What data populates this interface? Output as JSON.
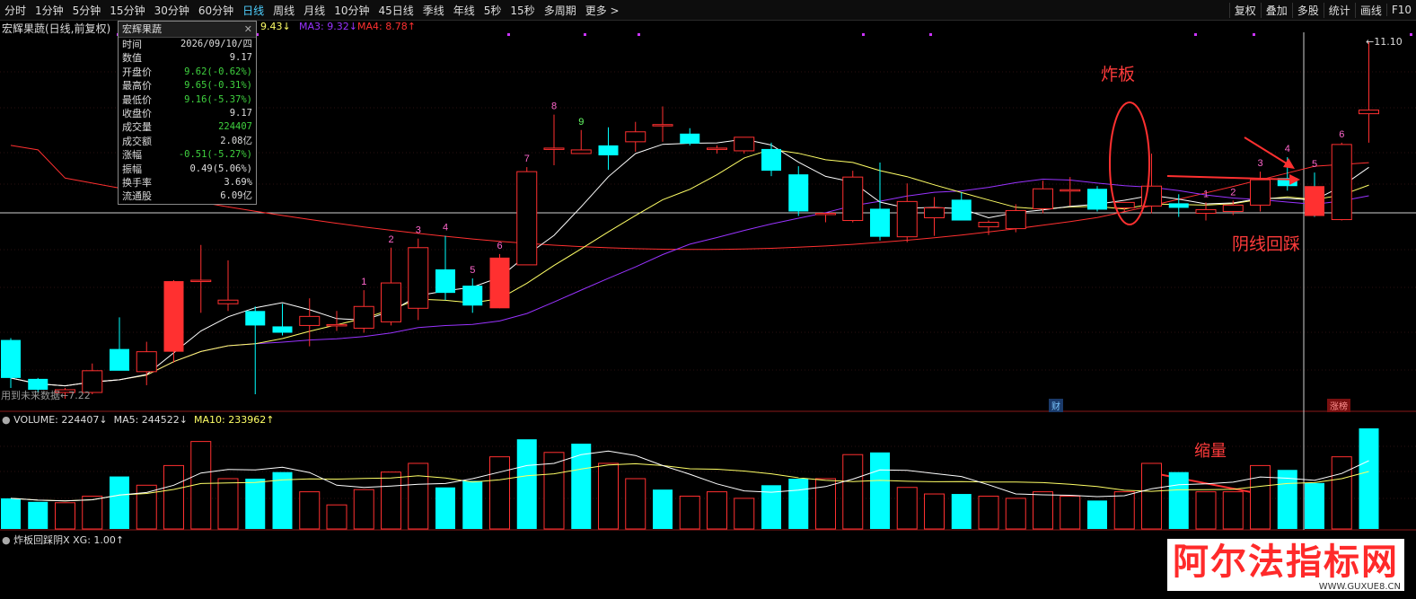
{
  "toolbar": {
    "periods": [
      "分时",
      "1分钟",
      "5分钟",
      "15分钟",
      "30分钟",
      "60分钟",
      "日线",
      "周线",
      "月线",
      "10分钟",
      "45日线",
      "季线",
      "年线",
      "5秒",
      "15秒",
      "多周期",
      "更多 >"
    ],
    "active_period": "日线",
    "tools": [
      "复权",
      "叠加",
      "多股",
      "统计",
      "画线",
      "F10"
    ]
  },
  "header": {
    "stock_title": "宏辉果蔬(日线,前复权)",
    "ma2": "9.43↓",
    "ma3": "MA3: 9.32↓",
    "ma4": "MA4: 8.78↑"
  },
  "infobox": {
    "title": "宏辉果蔬",
    "rows": [
      {
        "k": "时间",
        "v": "2026/09/10/四",
        "g": false
      },
      {
        "k": "数值",
        "v": "9.17",
        "g": false
      },
      {
        "k": "开盘价",
        "v": "9.62(-0.62%)",
        "g": true
      },
      {
        "k": "最高价",
        "v": "9.65(-0.31%)",
        "g": true
      },
      {
        "k": "最低价",
        "v": "9.16(-5.37%)",
        "g": true
      },
      {
        "k": "收盘价",
        "v": "9.17",
        "g": false
      },
      {
        "k": "成交量",
        "v": "224407",
        "g": true
      },
      {
        "k": "成交额",
        "v": "2.08亿",
        "g": false
      },
      {
        "k": "涨幅",
        "v": "-0.51(-5.27%)",
        "g": true
      },
      {
        "k": "振幅",
        "v": "0.49(5.06%)",
        "g": false
      },
      {
        "k": "换手率",
        "v": "3.69%",
        "g": false
      },
      {
        "k": "流通股",
        "v": "6.09亿",
        "g": false
      }
    ]
  },
  "price_labels": {
    "high": "11.10",
    "low": "7.22",
    "future": "用到未来数据"
  },
  "volume_header": {
    "volume": "VOLUME: 224407↓",
    "ma5": "MA5: 244522↓",
    "ma10": "MA10: 233962↑"
  },
  "indicator_header": "炸板回踩阴X XG: 1.00↑",
  "annotations": {
    "zhaban": "炸板",
    "yinxian": "阴线回踩",
    "suoliang": "缩量"
  },
  "tags": {
    "cai": "财",
    "zhangbang": "涨榜"
  },
  "watermark": {
    "text": "阿尔法指标网",
    "url": "WWW.GUXUE8.CN"
  },
  "colors": {
    "up": "#ff3030",
    "down": "#00ffff",
    "ma1": "#ffffff",
    "ma2": "#ffff66",
    "ma3": "#9933ff",
    "ma4": "#ff3030"
  },
  "chart_data": {
    "type": "candlestick",
    "price_range": [
      7.22,
      11.1
    ],
    "candles": [
      {
        "o": 7.8,
        "h": 7.82,
        "l": 7.27,
        "c": 7.38,
        "up": false
      },
      {
        "o": 7.37,
        "h": 7.38,
        "l": 7.22,
        "c": 7.25,
        "up": false
      },
      {
        "o": 7.22,
        "h": 7.27,
        "l": 7.15,
        "c": 7.25,
        "up": true
      },
      {
        "o": 7.22,
        "h": 7.54,
        "l": 7.2,
        "c": 7.46,
        "up": true
      },
      {
        "o": 7.7,
        "h": 8.05,
        "l": 7.5,
        "c": 7.46,
        "up": false
      },
      {
        "o": 7.45,
        "h": 7.78,
        "l": 7.3,
        "c": 7.67,
        "up": true
      },
      {
        "o": 7.67,
        "h": 8.46,
        "l": 7.55,
        "c": 8.45,
        "up": true
      },
      {
        "o": 8.46,
        "h": 8.85,
        "l": 8.1,
        "c": 8.46,
        "up": true
      },
      {
        "o": 8.2,
        "h": 8.68,
        "l": 8.12,
        "c": 8.24,
        "up": true
      },
      {
        "o": 8.12,
        "h": 8.17,
        "l": 7.2,
        "c": 7.96,
        "up": false
      },
      {
        "o": 7.88,
        "h": 8.2,
        "l": 7.85,
        "c": 7.95,
        "up": false
      },
      {
        "o": 7.96,
        "h": 8.26,
        "l": 7.73,
        "c": 8.06,
        "up": true
      },
      {
        "o": 7.96,
        "h": 8.12,
        "l": 7.9,
        "c": 7.97,
        "up": true
      },
      {
        "o": 7.93,
        "h": 8.35,
        "l": 7.88,
        "c": 8.17,
        "up": true
      },
      {
        "o": 8.0,
        "h": 8.82,
        "l": 7.96,
        "c": 8.43,
        "up": true
      },
      {
        "o": 8.15,
        "h": 8.92,
        "l": 8.02,
        "c": 8.82,
        "up": true
      },
      {
        "o": 8.58,
        "h": 8.95,
        "l": 8.24,
        "c": 8.32,
        "up": false
      },
      {
        "o": 8.4,
        "h": 8.48,
        "l": 8.1,
        "c": 8.18,
        "up": false
      },
      {
        "o": 8.15,
        "h": 8.75,
        "l": 8.15,
        "c": 8.71,
        "up": true
      },
      {
        "o": 8.63,
        "h": 9.71,
        "l": 8.63,
        "c": 9.66,
        "up": true
      },
      {
        "o": 9.92,
        "h": 10.29,
        "l": 9.73,
        "c": 9.91,
        "up": true
      },
      {
        "o": 9.86,
        "h": 10.12,
        "l": 9.87,
        "c": 9.9,
        "up": true
      },
      {
        "o": 9.95,
        "h": 10.15,
        "l": 9.68,
        "c": 9.84,
        "up": false
      },
      {
        "o": 10.1,
        "h": 10.21,
        "l": 9.88,
        "c": 9.99,
        "up": true
      },
      {
        "o": 10.18,
        "h": 10.38,
        "l": 9.99,
        "c": 10.17,
        "up": true
      },
      {
        "o": 10.08,
        "h": 10.14,
        "l": 9.95,
        "c": 9.97,
        "up": false
      },
      {
        "o": 9.91,
        "h": 9.95,
        "l": 9.86,
        "c": 9.92,
        "up": true
      },
      {
        "o": 9.89,
        "h": 10.01,
        "l": 9.86,
        "c": 10.04,
        "up": true
      },
      {
        "o": 9.91,
        "h": 9.98,
        "l": 9.61,
        "c": 9.67,
        "up": false
      },
      {
        "o": 9.63,
        "h": 9.72,
        "l": 9.17,
        "c": 9.22,
        "up": false
      },
      {
        "o": 9.2,
        "h": 9.2,
        "l": 9.1,
        "c": 9.19,
        "up": true
      },
      {
        "o": 9.12,
        "h": 9.67,
        "l": 9.1,
        "c": 9.6,
        "up": true
      },
      {
        "o": 9.25,
        "h": 9.76,
        "l": 8.9,
        "c": 8.94,
        "up": false
      },
      {
        "o": 8.94,
        "h": 9.53,
        "l": 8.88,
        "c": 9.33,
        "up": true
      },
      {
        "o": 9.15,
        "h": 9.38,
        "l": 8.95,
        "c": 9.26,
        "up": true
      },
      {
        "o": 9.35,
        "h": 9.43,
        "l": 9.14,
        "c": 9.12,
        "up": false
      },
      {
        "o": 9.05,
        "h": 9.12,
        "l": 8.96,
        "c": 9.1,
        "up": true
      },
      {
        "o": 9.03,
        "h": 9.3,
        "l": 8.99,
        "c": 9.23,
        "up": true
      },
      {
        "o": 9.25,
        "h": 9.56,
        "l": 9.2,
        "c": 9.47,
        "up": true
      },
      {
        "o": 9.45,
        "h": 9.6,
        "l": 9.28,
        "c": 9.46,
        "up": true
      },
      {
        "o": 9.47,
        "h": 9.5,
        "l": 9.22,
        "c": 9.24,
        "up": false
      },
      {
        "o": 9.26,
        "h": 9.32,
        "l": 9.22,
        "c": 9.32,
        "up": true
      },
      {
        "o": 9.28,
        "h": 9.86,
        "l": 9.2,
        "c": 9.5,
        "up": true
      },
      {
        "o": 9.31,
        "h": 9.41,
        "l": 9.16,
        "c": 9.26,
        "up": false
      },
      {
        "o": 9.24,
        "h": 9.32,
        "l": 9.12,
        "c": 9.2,
        "up": true
      },
      {
        "o": 9.22,
        "h": 9.34,
        "l": 9.18,
        "c": 9.29,
        "up": true
      },
      {
        "o": 9.29,
        "h": 9.66,
        "l": 9.22,
        "c": 9.57,
        "up": true
      },
      {
        "o": 9.59,
        "h": 9.82,
        "l": 9.45,
        "c": 9.5,
        "up": false
      },
      {
        "o": 9.5,
        "h": 9.65,
        "l": 9.16,
        "c": 9.17,
        "up": false
      },
      {
        "o": 9.13,
        "h": 9.98,
        "l": 9.12,
        "c": 9.96,
        "up": true
      },
      {
        "o": 10.3,
        "h": 11.1,
        "l": 9.98,
        "c": 10.34,
        "up": true
      }
    ],
    "candle_marks": [
      {
        "i": 13,
        "t": "1",
        "color": "#ff66cc"
      },
      {
        "i": 14,
        "t": "2",
        "color": "#ff66cc"
      },
      {
        "i": 15,
        "t": "3",
        "color": "#ff66cc"
      },
      {
        "i": 16,
        "t": "4",
        "color": "#ff66cc"
      },
      {
        "i": 17,
        "t": "5",
        "color": "#ff66cc"
      },
      {
        "i": 18,
        "t": "6",
        "color": "#ff66cc"
      },
      {
        "i": 19,
        "t": "7",
        "color": "#ff66cc"
      },
      {
        "i": 20,
        "t": "8",
        "color": "#ff66cc"
      },
      {
        "i": 21,
        "t": "9",
        "color": "#66ff66"
      },
      {
        "i": 44,
        "t": "1",
        "color": "#ff66cc"
      },
      {
        "i": 45,
        "t": "2",
        "color": "#ff66cc"
      },
      {
        "i": 46,
        "t": "3",
        "color": "#ff66cc"
      },
      {
        "i": 47,
        "t": "4",
        "color": "#ff66cc"
      },
      {
        "i": 48,
        "t": "5",
        "color": "#ff66cc"
      },
      {
        "i": 49,
        "t": "6",
        "color": "#ff66cc"
      }
    ],
    "volume": [
      {
        "v": 70,
        "up": false
      },
      {
        "v": 62,
        "up": false
      },
      {
        "v": 60,
        "up": true
      },
      {
        "v": 75,
        "up": true
      },
      {
        "v": 120,
        "up": false
      },
      {
        "v": 100,
        "up": true
      },
      {
        "v": 145,
        "up": true
      },
      {
        "v": 200,
        "up": true
      },
      {
        "v": 115,
        "up": true
      },
      {
        "v": 115,
        "up": false
      },
      {
        "v": 130,
        "up": false
      },
      {
        "v": 85,
        "up": true
      },
      {
        "v": 55,
        "up": true
      },
      {
        "v": 90,
        "up": true
      },
      {
        "v": 130,
        "up": true
      },
      {
        "v": 150,
        "up": true
      },
      {
        "v": 95,
        "up": false
      },
      {
        "v": 110,
        "up": false
      },
      {
        "v": 165,
        "up": true
      },
      {
        "v": 205,
        "up": false
      },
      {
        "v": 175,
        "up": true
      },
      {
        "v": 195,
        "up": false
      },
      {
        "v": 150,
        "up": true
      },
      {
        "v": 115,
        "up": true
      },
      {
        "v": 90,
        "up": false
      },
      {
        "v": 75,
        "up": true
      },
      {
        "v": 85,
        "up": true
      },
      {
        "v": 70,
        "up": true
      },
      {
        "v": 100,
        "up": false
      },
      {
        "v": 115,
        "up": false
      },
      {
        "v": 115,
        "up": true
      },
      {
        "v": 170,
        "up": true
      },
      {
        "v": 175,
        "up": false
      },
      {
        "v": 95,
        "up": true
      },
      {
        "v": 80,
        "up": true
      },
      {
        "v": 80,
        "up": false
      },
      {
        "v": 75,
        "up": true
      },
      {
        "v": 70,
        "up": true
      },
      {
        "v": 85,
        "up": true
      },
      {
        "v": 75,
        "up": true
      },
      {
        "v": 65,
        "up": false
      },
      {
        "v": 85,
        "up": true
      },
      {
        "v": 150,
        "up": true
      },
      {
        "v": 130,
        "up": false
      },
      {
        "v": 85,
        "up": true
      },
      {
        "v": 85,
        "up": true
      },
      {
        "v": 145,
        "up": true
      },
      {
        "v": 135,
        "up": false
      },
      {
        "v": 105,
        "up": false
      },
      {
        "v": 165,
        "up": true
      },
      {
        "v": 230,
        "up": false
      }
    ]
  }
}
